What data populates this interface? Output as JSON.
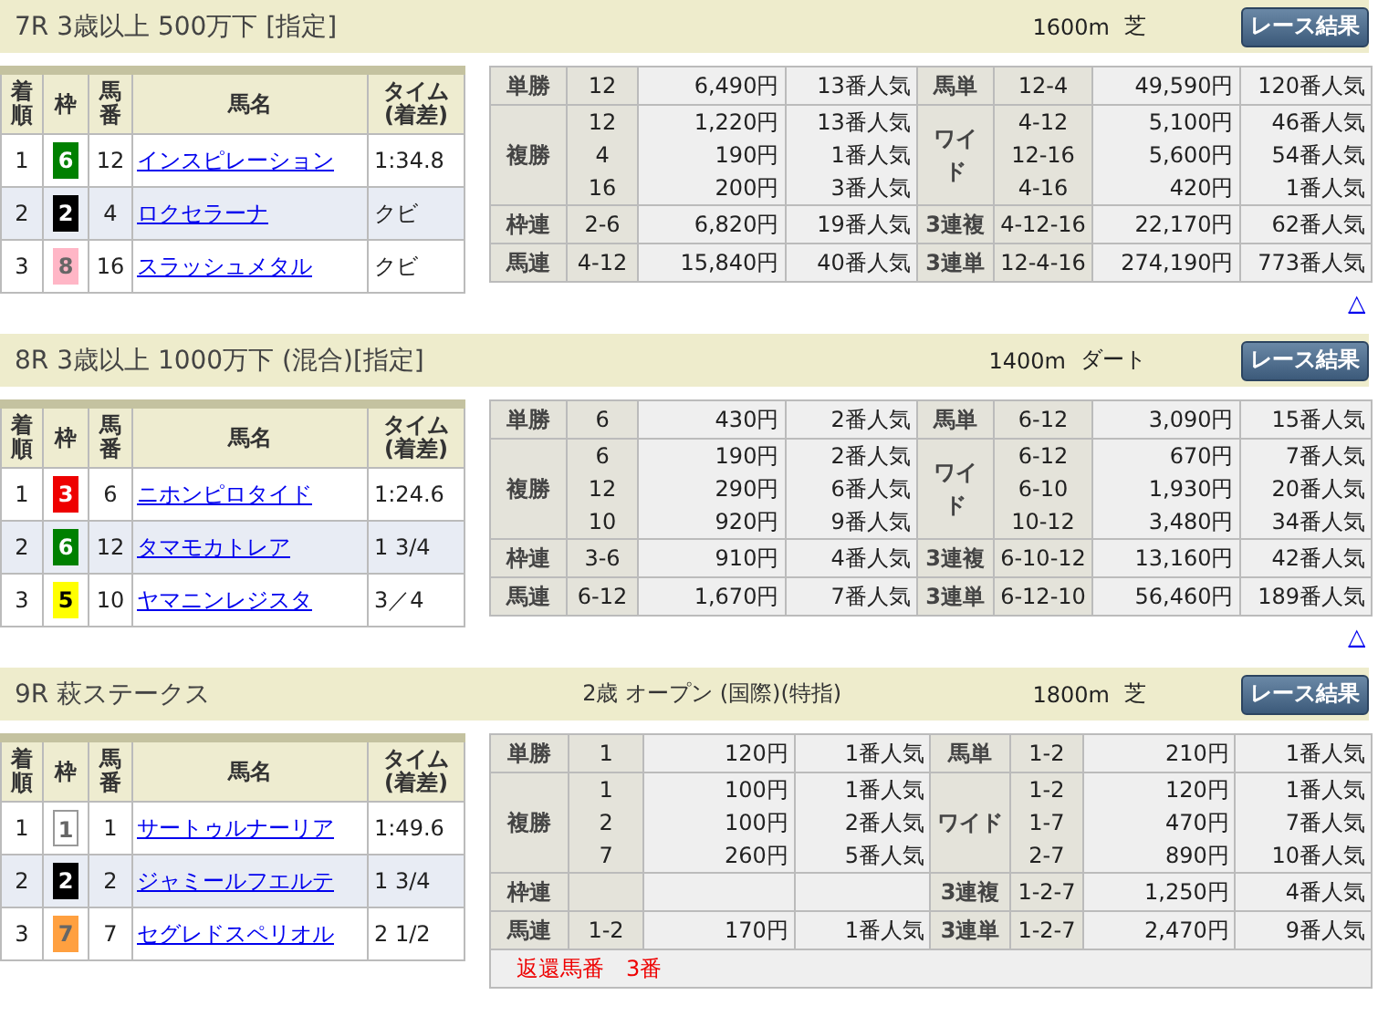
{
  "races": [
    {
      "title": "7R 3歳以上 500万下 [指定]",
      "distance": "1600m",
      "surface": "芝",
      "button": "レース結果",
      "columns": [
        "着順",
        "枠",
        "馬番",
        "馬名",
        "タイム\n(着差)"
      ],
      "results": [
        {
          "place": "1",
          "gate": "6",
          "color": "#008000",
          "number": "12",
          "name": "インスピレーション",
          "time": "1:34.8"
        },
        {
          "place": "2",
          "gate": "2",
          "color": "#000000",
          "number": "4",
          "name": "ロクセラーナ",
          "time": "クビ"
        },
        {
          "place": "3",
          "gate": "8",
          "color": "#ffb6c6",
          "number": "16",
          "name": "スラッシュメタル",
          "time": "クビ"
        }
      ],
      "payouts": [
        {
          "left": {
            "label": "単勝",
            "entries": [
              {
                "combo": "12",
                "amount": "6,490円",
                "popularity": "13番人気"
              }
            ]
          },
          "right": {
            "label": "馬単",
            "entries": [
              {
                "combo": "12-4",
                "amount": "49,590円",
                "popularity": "120番人気"
              }
            ]
          }
        },
        {
          "left": {
            "label": "複勝",
            "entries": [
              {
                "combo": "12",
                "amount": "1,220円",
                "popularity": "13番人気"
              },
              {
                "combo": "4",
                "amount": "190円",
                "popularity": "1番人気"
              },
              {
                "combo": "16",
                "amount": "200円",
                "popularity": "3番人気"
              }
            ]
          },
          "right": {
            "label": "ワイド",
            "entries": [
              {
                "combo": "4-12",
                "amount": "5,100円",
                "popularity": "46番人気"
              },
              {
                "combo": "12-16",
                "amount": "5,600円",
                "popularity": "54番人気"
              },
              {
                "combo": "4-16",
                "amount": "420円",
                "popularity": "1番人気"
              }
            ]
          }
        },
        {
          "left": {
            "label": "枠連",
            "entries": [
              {
                "combo": "2-6",
                "amount": "6,820円",
                "popularity": "19番人気"
              }
            ]
          },
          "right": {
            "label": "3連複",
            "entries": [
              {
                "combo": "4-12-16",
                "amount": "22,170円",
                "popularity": "62番人気"
              }
            ]
          }
        },
        {
          "left": {
            "label": "馬連",
            "entries": [
              {
                "combo": "4-12",
                "amount": "15,840円",
                "popularity": "40番人気"
              }
            ]
          },
          "right": {
            "label": "3連単",
            "entries": [
              {
                "combo": "12-4-16",
                "amount": "274,190円",
                "popularity": "773番人気"
              }
            ]
          }
        }
      ],
      "top_link": "△"
    },
    {
      "title": "8R 3歳以上 1000万下 (混合)[指定]",
      "distance": "1400m",
      "surface": "ダート",
      "button": "レース結果",
      "columns": [
        "着順",
        "枠",
        "馬番",
        "馬名",
        "タイム\n(着差)"
      ],
      "results": [
        {
          "place": "1",
          "gate": "3",
          "color": "#ee0000",
          "number": "6",
          "name": "ニホンピロタイド",
          "time": "1:24.6"
        },
        {
          "place": "2",
          "gate": "6",
          "color": "#008000",
          "number": "12",
          "name": "タマモカトレア",
          "time": "1 3/4"
        },
        {
          "place": "3",
          "gate": "5",
          "color": "#ffff00",
          "number": "10",
          "name": "ヤマニンレジスタ",
          "time": "3／4"
        }
      ],
      "payouts": [
        {
          "left": {
            "label": "単勝",
            "entries": [
              {
                "combo": "6",
                "amount": "430円",
                "popularity": "2番人気"
              }
            ]
          },
          "right": {
            "label": "馬単",
            "entries": [
              {
                "combo": "6-12",
                "amount": "3,090円",
                "popularity": "15番人気"
              }
            ]
          }
        },
        {
          "left": {
            "label": "複勝",
            "entries": [
              {
                "combo": "6",
                "amount": "190円",
                "popularity": "2番人気"
              },
              {
                "combo": "12",
                "amount": "290円",
                "popularity": "6番人気"
              },
              {
                "combo": "10",
                "amount": "920円",
                "popularity": "9番人気"
              }
            ]
          },
          "right": {
            "label": "ワイド",
            "entries": [
              {
                "combo": "6-12",
                "amount": "670円",
                "popularity": "7番人気"
              },
              {
                "combo": "6-10",
                "amount": "1,930円",
                "popularity": "20番人気"
              },
              {
                "combo": "10-12",
                "amount": "3,480円",
                "popularity": "34番人気"
              }
            ]
          }
        },
        {
          "left": {
            "label": "枠連",
            "entries": [
              {
                "combo": "3-6",
                "amount": "910円",
                "popularity": "4番人気"
              }
            ]
          },
          "right": {
            "label": "3連複",
            "entries": [
              {
                "combo": "6-10-12",
                "amount": "13,160円",
                "popularity": "42番人気"
              }
            ]
          }
        },
        {
          "left": {
            "label": "馬連",
            "entries": [
              {
                "combo": "6-12",
                "amount": "1,670円",
                "popularity": "7番人気"
              }
            ]
          },
          "right": {
            "label": "3連単",
            "entries": [
              {
                "combo": "6-12-10",
                "amount": "56,460円",
                "popularity": "189番人気"
              }
            ]
          }
        }
      ],
      "top_link": "△"
    },
    {
      "title": "9R 萩ステークス",
      "subtitle": "2歳 オープン (国際)(特指)",
      "distance": "1800m",
      "surface": "芝",
      "button": "レース結果",
      "columns": [
        "着順",
        "枠",
        "馬番",
        "馬名",
        "タイム\n(着差)"
      ],
      "results": [
        {
          "place": "1",
          "gate": "1",
          "color": "#ffffff",
          "number": "1",
          "name": "サートゥルナーリア",
          "time": "1:49.6"
        },
        {
          "place": "2",
          "gate": "2",
          "color": "#000000",
          "number": "2",
          "name": "ジャミールフエルテ",
          "time": "1 3/4"
        },
        {
          "place": "3",
          "gate": "7",
          "color": "#ffa040",
          "number": "7",
          "name": "セグレドスペリオル",
          "time": "2 1/2"
        }
      ],
      "payouts": [
        {
          "left": {
            "label": "単勝",
            "entries": [
              {
                "combo": "1",
                "amount": "120円",
                "popularity": "1番人気"
              }
            ]
          },
          "right": {
            "label": "馬単",
            "entries": [
              {
                "combo": "1-2",
                "amount": "210円",
                "popularity": "1番人気"
              }
            ]
          }
        },
        {
          "left": {
            "label": "複勝",
            "entries": [
              {
                "combo": "1",
                "amount": "100円",
                "popularity": "1番人気"
              },
              {
                "combo": "2",
                "amount": "100円",
                "popularity": "2番人気"
              },
              {
                "combo": "7",
                "amount": "260円",
                "popularity": "5番人気"
              }
            ]
          },
          "right": {
            "label": "ワイド",
            "entries": [
              {
                "combo": "1-2",
                "amount": "120円",
                "popularity": "1番人気"
              },
              {
                "combo": "1-7",
                "amount": "470円",
                "popularity": "7番人気"
              },
              {
                "combo": "2-7",
                "amount": "890円",
                "popularity": "10番人気"
              }
            ]
          }
        },
        {
          "left": {
            "label": "枠連"
          },
          "right": {
            "label": "3連複",
            "entries": [
              {
                "combo": "1-2-7",
                "amount": "1,250円",
                "popularity": "4番人気"
              }
            ]
          }
        },
        {
          "left": {
            "label": "馬連",
            "entries": [
              {
                "combo": "1-2",
                "amount": "170円",
                "popularity": "1番人気"
              }
            ]
          },
          "right": {
            "label": "3連単",
            "entries": [
              {
                "combo": "1-2-7",
                "amount": "2,470円",
                "popularity": "9番人気"
              }
            ]
          }
        }
      ],
      "note": "返還馬番　3番"
    }
  ]
}
